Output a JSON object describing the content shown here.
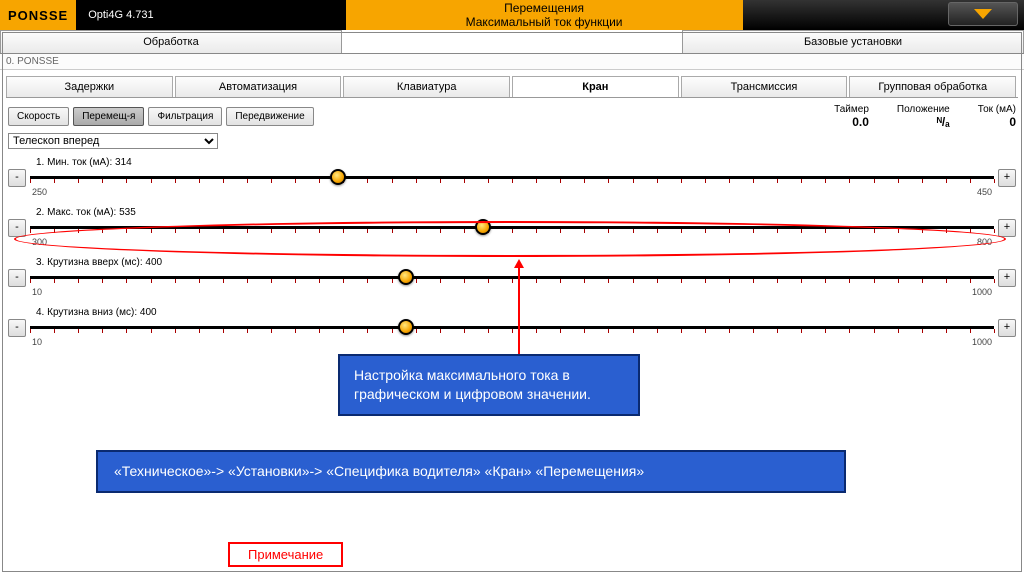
{
  "brand": "PONSSE",
  "version": "Opti4G 4.731",
  "title_line1": "Перемещения",
  "title_line2": "Максимальный ток функции",
  "top_tabs": {
    "left": "Обработка",
    "right": "Базовые установки"
  },
  "breadcrumb": "0. PONSSE",
  "subtabs": [
    "Задержки",
    "Автоматизация",
    "Клавиатура",
    "Кран",
    "Трансмиссия",
    "Групповая обработка"
  ],
  "subtab_active": 3,
  "modes": [
    "Скорость",
    "Перемещ-я",
    "Фильтрация",
    "Передвижение"
  ],
  "mode_active": 1,
  "readouts": {
    "timer_label": "Таймер",
    "timer_val": "0.0",
    "position_label": "Положение",
    "position_val": "ᴺ/ₐ",
    "current_label": "Ток (мА)",
    "current_val": "0"
  },
  "function_selected": "Телескоп вперед",
  "sliders": [
    {
      "label": "1. Мин. ток  (мА): 314",
      "min": "250",
      "max": "450",
      "pct": 32
    },
    {
      "label": "2. Макс. ток  (мА): 535",
      "min": "300",
      "max": "800",
      "pct": 47
    },
    {
      "label": "3. Крутизна вверх (мс): 400",
      "min": "10",
      "max": "1000",
      "pct": 39
    },
    {
      "label": "4. Крутизна вниз (мс): 400",
      "min": "10",
      "max": "1000",
      "pct": 39
    }
  ],
  "note_top_l1": "Настройка максимального тока в",
  "note_top_l2": "графическом и цифровом значении.",
  "note_path": "«Техническое»-> «Установки»-> «Специфика водителя» «Кран» «Перемещения»",
  "note_label": "Примечание"
}
